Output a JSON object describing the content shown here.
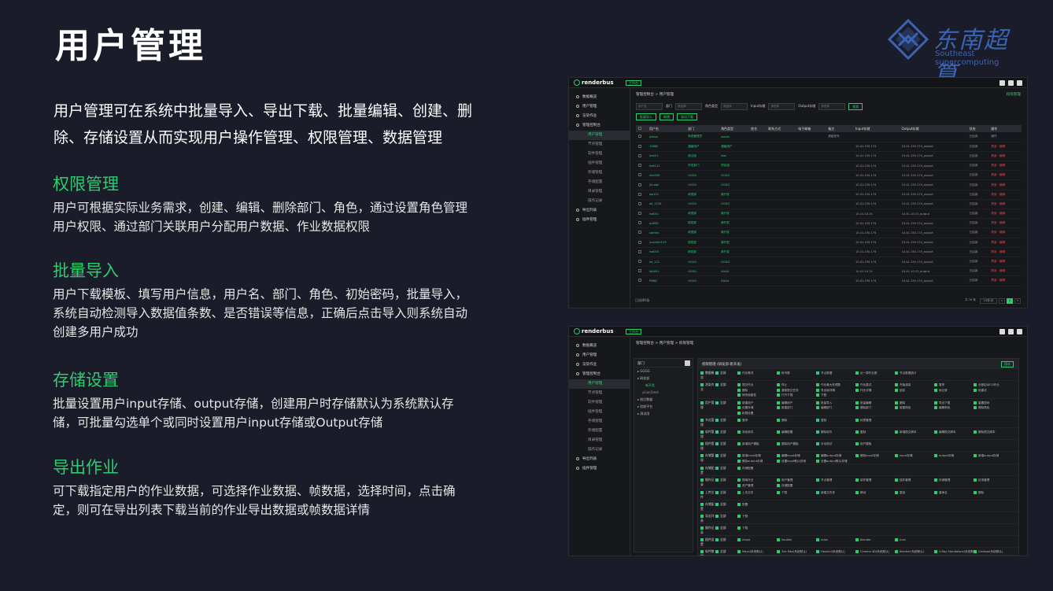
{
  "slide": {
    "title": "用户管理",
    "logo_cn": "东南超算",
    "logo_en": "Southeast supercomputing",
    "intro": "用户管理可在系统中批量导入、导出下载、批量编辑、创建、删除、存储设置从而实现用户操作管理、权限管理、数据管理",
    "sections": [
      {
        "heading": "权限管理",
        "body": "用户可根据实际业务需求，创建、编辑、删除部门、角色，通过设置角色管理用户权限、通过部门关联用户分配用户数据、作业数据权限"
      },
      {
        "heading": "批量导入",
        "body": "用户下载模板、填写用户信息，用户名、部门、角色、初始密码，批量导入，系统自动检测导入数据值条数、是否错误等信息，正确后点击导入则系统自动创建多用户成功"
      },
      {
        "heading": "存储设置",
        "body": "批量设置用户input存储、output存储，创建用户时存储默认为系统默认存储，可批量勾选单个或同时设置用户input存储或Output存储"
      },
      {
        "heading": "导出作业",
        "body": "可下载指定用户的作业数据，可选择作业数据、帧数据，选择时间，点击确定，则可在导出列表下载当前的作业导出数据或帧数据详情"
      }
    ]
  },
  "app": {
    "brand": "renderbus",
    "workspace": "工作台",
    "sidebar": [
      {
        "label": "数据概览",
        "sub": false
      },
      {
        "label": "用户管理",
        "sub": false
      },
      {
        "label": "渲染作业",
        "sub": false
      },
      {
        "label": "管理控制台",
        "sub": false
      },
      {
        "label": "用户管理",
        "sub": true,
        "active": true
      },
      {
        "label": "节点管理",
        "sub": true
      },
      {
        "label": "软件管理",
        "sub": true
      },
      {
        "label": "插件管理",
        "sub": true
      },
      {
        "label": "存储管理",
        "sub": true
      },
      {
        "label": "存储配置",
        "sub": true
      },
      {
        "label": "目录管理",
        "sub": true
      },
      {
        "label": "操作记录",
        "sub": true
      },
      {
        "label": "导出列表",
        "sub": false
      },
      {
        "label": "插件管理",
        "sub": false
      }
    ],
    "breadcrumb1": "管理控制台 > 用户管理",
    "breadcrumb_right": "权限管理",
    "filters": {
      "user_ph": "用户名",
      "dept_label": "部门",
      "dept_ph": "请选择",
      "role_label": "角色类型",
      "role_ph": "请选择",
      "input_label": "Input存储",
      "input_ph": "请选择",
      "output_label": "Output存储",
      "output_ph": "请选择",
      "search": "搜索"
    },
    "buttons": {
      "import": "批量导入",
      "add": "新增",
      "export": "导出下载"
    },
    "columns": [
      "用户名",
      "部门",
      "角色类型",
      "姓名",
      "联系方式",
      "电子邮箱",
      "备注",
      "Input存储",
      "Output存储",
      "状态",
      "操作"
    ],
    "rows": [
      [
        "admin",
        "系统管理员",
        "admin",
        "",
        "",
        "",
        "超级账号",
        "",
        "",
        "已启用",
        "操作"
      ],
      [
        "13862",
        "超级用户",
        "超级用户",
        "",
        "",
        "",
        "",
        "10.41.150.174",
        "10.41.150.174_output",
        "已启用",
        "禁用 · 编辑"
      ],
      [
        "test01",
        "测试组",
        "test",
        "",
        "",
        "",
        "",
        "10.41.150.174",
        "10.41.150.174_output",
        "已启用",
        "禁用 · 编辑"
      ],
      [
        "test111",
        "开发部门",
        "项目组",
        "",
        "",
        "",
        "",
        "10.41.150.174",
        "10.41.150.174_output",
        "已启用",
        "禁用 · 编辑"
      ],
      [
        "zhu090",
        "GGGG",
        "GGGG",
        "",
        "",
        "",
        "",
        "10.41.150.174",
        "10.41.150.174_output",
        "已启用",
        "禁用 · 编辑"
      ],
      [
        "Jihudai",
        "GGGG",
        "GGGG",
        "",
        "",
        "",
        "",
        "10.41.150.174",
        "10.41.150.174_output",
        "已启用",
        "禁用 · 编辑"
      ],
      [
        "wp112",
        "研发部",
        "新开发",
        "",
        "",
        "",
        "",
        "10.41.150.174",
        "10.41.150.174_output",
        "已启用",
        "禁用 · 编辑"
      ],
      [
        "wt_1234",
        "GGGG",
        "GGGG",
        "",
        "",
        "",
        "",
        "10.41.150.174",
        "10.41.150.174_output",
        "已启用",
        "禁用 · 编辑"
      ],
      [
        "wd001",
        "研发部",
        "新开发",
        "",
        "",
        "",
        "",
        "10.41.10.15",
        "10.41.10.15_output",
        "已启用",
        "禁用 · 编辑"
      ],
      [
        "tpl009",
        "研发部",
        "新开发",
        "",
        "",
        "",
        "",
        "10.41.150.174",
        "10.41.150.174_output",
        "已启用",
        "禁用 · 编辑"
      ],
      [
        "starlex",
        "研发部",
        "新开发",
        "",
        "",
        "",
        "",
        "10.41.150.174",
        "10.41.150.174_output",
        "已启用",
        "禁用 · 编辑"
      ],
      [
        "yuanfen123",
        "研发部",
        "新开发",
        "",
        "",
        "",
        "",
        "10.41.150.174",
        "10.41.150.174_output",
        "已启用",
        "禁用 · 编辑"
      ],
      [
        "wd003",
        "研发部",
        "新开发",
        "",
        "",
        "",
        "",
        "10.41.150.174",
        "10.41.150.174_output",
        "已启用",
        "禁用 · 编辑"
      ],
      [
        "wt_121",
        "GGGG",
        "GGGG",
        "",
        "",
        "",
        "",
        "10.41.150.174",
        "10.41.150.174_output",
        "已启用",
        "禁用 · 编辑"
      ],
      [
        "fgh001",
        "GGGG",
        "AAAA",
        "",
        "",
        "",
        "",
        "10.41.10.15",
        "10.41.10.15_output",
        "已启用",
        "禁用 · 编辑"
      ],
      [
        "f9862",
        "GGGG",
        "AAAA",
        "",
        "",
        "",
        "",
        "10.41.150.174",
        "10.41.150.174_output",
        "已启用",
        "禁用 · 编辑"
      ]
    ],
    "pager_left": "已选择0条",
    "pager_total": "共 16 条",
    "pager_size": "10条/页",
    "pager_pages": [
      "<",
      "1",
      ">"
    ],
    "breadcrumb2": "管理控制台 > 用户管理 > 权限管理",
    "tree": {
      "header": "部门",
      "nodes": [
        "GGGG",
        "研发部",
        "新开发",
        "yican1test",
        "前后数据",
        "验收平台",
        "测试用"
      ]
    },
    "perm_header": "权限管理 (研发部-新开发)",
    "perm_save": "保存",
    "perm_rows": [
      {
        "cat": "数据概览",
        "items": [
          "作业概况",
          "帐号数",
          "节点数据",
          "近一周作业数",
          "节点数据统计"
        ]
      },
      {
        "cat": "渲染作业",
        "items": [
          "提交作业",
          "停止",
          "作业最大处理数",
          "作业重试",
          "开始渲染",
          "暂停",
          "全部启动CG作业",
          "删除",
          "重新提交任务",
          "导出帧详情",
          "作业详情",
          "锁定",
          "帧记录",
          "帧重试",
          "修改帧属性",
          "打开下载",
          "下载"
        ]
      },
      {
        "cat": "用户管理",
        "items": [
          "新建用户",
          "编辑用户",
          "批量导入",
          "批量编辑",
          "删除",
          "导出下载",
          "重置密码",
          "设置存储",
          "新建部门",
          "编辑部门",
          "删除部门",
          "新建角色",
          "编辑角色",
          "删除角色",
          "权限设置"
        ]
      },
      {
        "cat": "节点管理",
        "items": [
          "暂停",
          "删除",
          "复制",
          "标签管理"
        ]
      },
      {
        "cat": "软件管理",
        "items": [
          "添加软件",
          "编辑配置",
          "删除软件",
          "复制",
          "新增提交脚本",
          "编辑提交脚本",
          "删除提交脚本"
        ]
      },
      {
        "cat": "插件管理",
        "items": [
          "新增用户模板",
          "删除用户模板",
          "手动测试",
          "用户模板"
        ]
      },
      {
        "cat": "存储管理",
        "items": [
          "新增input存储",
          "编辑input存储",
          "编辑output存储",
          "删除input存储",
          "input存储",
          "output存储",
          "新增output存储",
          "删除output存储",
          "设置input默认存储",
          "设置output默认存储"
        ]
      },
      {
        "cat": "存储配置",
        "items": [
          "存储配置"
        ]
      },
      {
        "cat": "操作记录",
        "items": [
          "搜索作业",
          "用户管理",
          "节点管理",
          "软件管理",
          "插件管理",
          "存储管理",
          "目录管理",
          "资产管理",
          "存储配置"
        ]
      },
      {
        "cat": "上传文件",
        "items": [
          "上传文件",
          "下载",
          "新建文件夹",
          "移动",
          "复制",
          "重命名",
          "删除"
        ]
      },
      {
        "cat": "存储配置",
        "items": [
          "配置"
        ]
      },
      {
        "cat": "导出列表",
        "items": [
          "下载"
        ]
      },
      {
        "cat": "操作记录",
        "items": [
          "下载"
        ]
      },
      {
        "cat": "插件设置",
        "items": [
          "maya",
          "houdini",
          "nuke",
          "blender",
          "max"
        ]
      },
      {
        "cat": "软件数据",
        "items": [
          "Maya(系统默认)",
          "3ds Max(系统默认)",
          "Houdini(系统默认)",
          "Cinema 4D(系统默认)",
          "Blender(系统默认)",
          "V-Ray Standalone(系统默认)",
          "Clarisse(系统默认)",
          "Nuke(系统默认)",
          "Katana(系统默认)",
          "Terragen(系统默认)",
          "maya_test1.0",
          "max_test1.0",
          "c4d_test1.0"
        ]
      }
    ],
    "perm_all": "全部"
  },
  "colors": {
    "accent": "#2ecc71",
    "bg": "#1a1d29",
    "logo_blue": "#3b63b5",
    "danger": "#e04b4b"
  }
}
